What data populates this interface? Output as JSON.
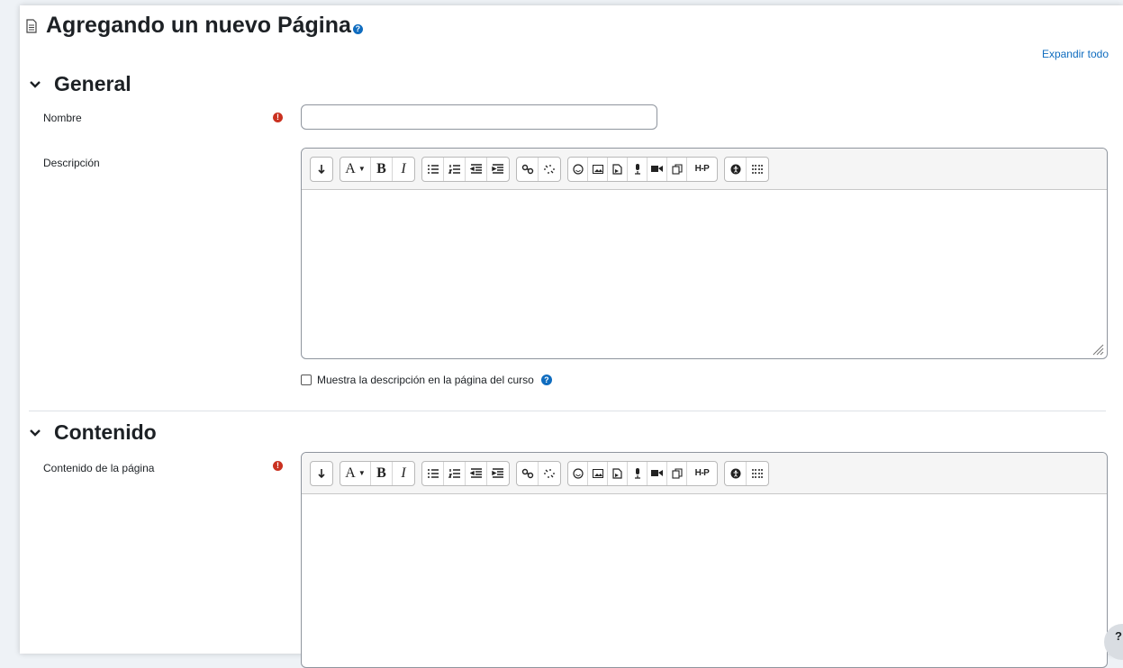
{
  "page": {
    "title": "Agregando un nuevo Página",
    "expand_all": "Expandir todo"
  },
  "general": {
    "heading": "General",
    "name_label": "Nombre",
    "name_value": "",
    "description_label": "Descripción",
    "show_description_label": "Muestra la descripción en la página del curso"
  },
  "content": {
    "heading": "Contenido",
    "page_content_label": "Contenido de la página"
  },
  "toolbar": {
    "groups": [
      [
        "toggle-toolbar-icon"
      ],
      [
        "font-style-icon",
        "bold-icon",
        "italic-icon"
      ],
      [
        "unordered-list-icon",
        "ordered-list-icon",
        "outdent-icon",
        "indent-icon"
      ],
      [
        "link-icon",
        "unlink-icon"
      ],
      [
        "emoji-icon",
        "image-icon",
        "media-icon",
        "record-audio-icon",
        "record-video-icon",
        "manage-files-icon",
        "h5p-icon"
      ],
      [
        "accessibility-icon",
        "screenreader-icon"
      ]
    ],
    "labels": {
      "font_style": "A",
      "bold": "B",
      "italic": "I",
      "h5p": "H-P"
    }
  },
  "icons": {
    "required": "required-icon",
    "help": "help-icon",
    "collapse": "chevron-down-icon"
  },
  "colors": {
    "accent": "#0f6cbf",
    "required": "#ca3120"
  }
}
